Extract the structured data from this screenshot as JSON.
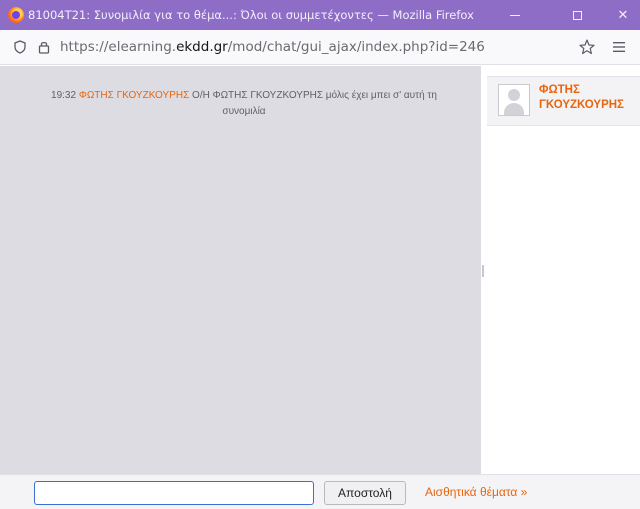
{
  "window": {
    "title": "81004T21: Συνομιλία για το θέμα...: Όλοι οι συμμετέχοντες — Mozilla Firefox",
    "close_glyph": "✕"
  },
  "addressbar": {
    "url_prefix": "https://elearning.",
    "url_domain": "ekdd.gr",
    "url_path": "/mod/chat/gui_ajax/index.php?id=246"
  },
  "chat": {
    "messages": [
      {
        "time": "19:32",
        "user": "ΦΩΤΗΣ ΓΚΟΥΖΚΟΥΡΗΣ",
        "text": "Ο/Η ΦΩΤΗΣ ΓΚΟΥΖΚΟΥΡΗΣ μόλις έχει μπει σ' αυτή τη συνομιλία"
      }
    ]
  },
  "users": [
    {
      "name": "ΦΩΤΗΣ ΓΚΟΥΖΚΟΥΡΗΣ"
    }
  ],
  "composer": {
    "input_value": "",
    "send_label": "Αποστολή",
    "themes_label": "Αισθητικά θέματα »"
  },
  "colors": {
    "accent": "#e8650e",
    "titlebar": "#8e6dc7",
    "message_area": "#dcdce2"
  },
  "icons": {
    "browser": "firefox-icon",
    "tracking": "shield-icon",
    "secure": "lock-icon",
    "bookmark": "star-icon",
    "menu": "hamburger-menu-icon"
  }
}
